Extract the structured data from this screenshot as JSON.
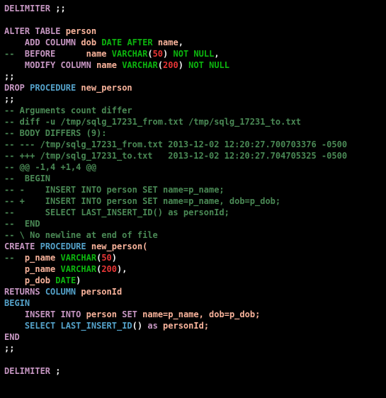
{
  "l1": {
    "kw": "DELIMITER",
    "op": ";;"
  },
  "l3": {
    "kw": "ALTER TABLE",
    "id": "person"
  },
  "l4": {
    "kw": "ADD COLUMN",
    "id": "dob",
    "t1": "DATE",
    "t2": "AFTER",
    "id2": "name",
    "op": ","
  },
  "l5": {
    "cm": "--",
    "kw": "BEFORE",
    "id": "name",
    "t1": "VARCHAR",
    "op1": "(",
    "n": "50",
    "op2": ")",
    "t2": "NOT",
    "t3": "NULL",
    "op3": ","
  },
  "l6": {
    "kw": "MODIFY COLUMN",
    "id": "name",
    "t1": "VARCHAR",
    "op1": "(",
    "n": "200",
    "op2": ")",
    "t2": "NOT",
    "t3": "NULL"
  },
  "l7": {
    "op": ";;"
  },
  "l8": {
    "kw": "DROP",
    "kw2": "PROCEDURE",
    "id": "new_person"
  },
  "l9": {
    "op": ";;"
  },
  "l10": "-- Arguments count differ",
  "l11": "-- diff -u /tmp/sqlg_17231_from.txt /tmp/sqlg_17231_to.txt",
  "l12": "-- BODY DIFFERS (9):",
  "l13": "-- --- /tmp/sqlg_17231_from.txt 2013-12-02 12:20:27.700703376 -0500",
  "l14": "-- +++ /tmp/sqlg_17231_to.txt   2013-12-02 12:20:27.704705325 -0500",
  "l15": "-- @@ -1,4 +1,4 @@",
  "l16": "--  BEGIN",
  "l17": "-- -    INSERT INTO person SET name=p_name;",
  "l18": "-- +    INSERT INTO person SET name=p_name, dob=p_dob;",
  "l19": "--      SELECT LAST_INSERT_ID() as personId;",
  "l20": "--  END",
  "l21": "-- \\ No newline at end of file",
  "l22": {
    "kw": "CREATE",
    "kw2": "PROCEDURE",
    "id": "new_person("
  },
  "l23": {
    "cm": "--",
    "id1": "p_name",
    "t": "VARCHAR",
    "op1": "(",
    "n": "50",
    "op2": ")"
  },
  "l24": {
    "id1": "p_name",
    "t": "VARCHAR",
    "op1": "(",
    "n": "200",
    "op2": "),"
  },
  "l25": {
    "id1": "p_dob",
    "t": "DATE",
    "op": ")"
  },
  "l26": {
    "kw": "RETURNS",
    "kw2": "COLUMN",
    "id": "personId"
  },
  "l27": {
    "kw": "BEGIN"
  },
  "l28": {
    "kw": "INSERT INTO",
    "id1": "person",
    "kw2": "SET",
    "id2": "name=p_name, dob=p_dob;"
  },
  "l29": {
    "kw": "SELECT",
    "fn": "LAST_INSERT_ID",
    "id": "()",
    "kw2": "as",
    "id2": "personId;"
  },
  "l30": {
    "kw": "END"
  },
  "l31": {
    "op": ";;"
  },
  "l33": {
    "kw": "DELIMITER",
    "op": ";"
  }
}
